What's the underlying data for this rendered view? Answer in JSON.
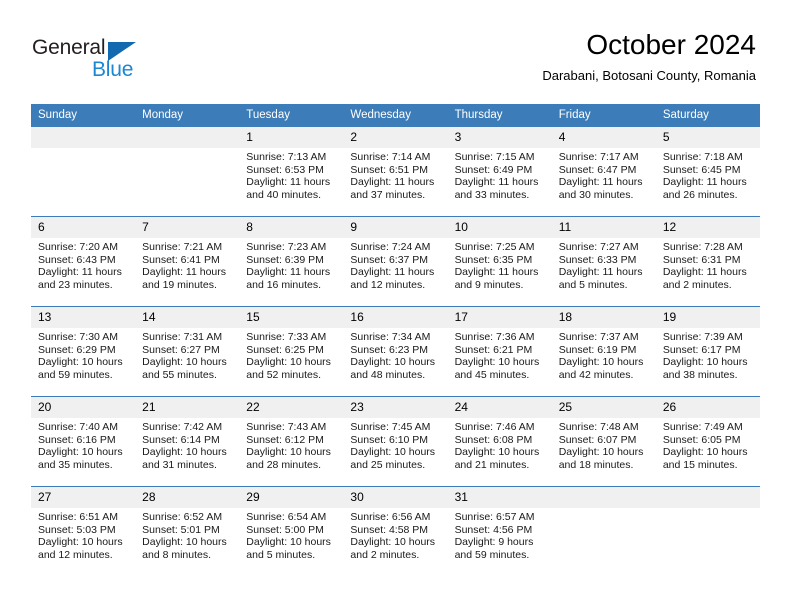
{
  "brand": {
    "name_top": "General",
    "name_bottom": "Blue",
    "accent_color": "#1269b0",
    "accent_color_light": "#1b87d4"
  },
  "header": {
    "title": "October 2024",
    "subtitle": "Darabani, Botosani County, Romania"
  },
  "theme": {
    "header_row_bg": "#3c7cb8",
    "daynum_bg": "#f0f0f0",
    "cell_bg": "#ffffff",
    "text_color": "#000000"
  },
  "weekday_headers": [
    "Sunday",
    "Monday",
    "Tuesday",
    "Wednesday",
    "Thursday",
    "Friday",
    "Saturday"
  ],
  "weeks": [
    [
      {
        "day": "",
        "sunrise": "",
        "sunset": "",
        "daylight": "",
        "empty": true
      },
      {
        "day": "",
        "sunrise": "",
        "sunset": "",
        "daylight": "",
        "empty": true
      },
      {
        "day": "1",
        "sunrise": "Sunrise: 7:13 AM",
        "sunset": "Sunset: 6:53 PM",
        "daylight": "Daylight: 11 hours and 40 minutes."
      },
      {
        "day": "2",
        "sunrise": "Sunrise: 7:14 AM",
        "sunset": "Sunset: 6:51 PM",
        "daylight": "Daylight: 11 hours and 37 minutes."
      },
      {
        "day": "3",
        "sunrise": "Sunrise: 7:15 AM",
        "sunset": "Sunset: 6:49 PM",
        "daylight": "Daylight: 11 hours and 33 minutes."
      },
      {
        "day": "4",
        "sunrise": "Sunrise: 7:17 AM",
        "sunset": "Sunset: 6:47 PM",
        "daylight": "Daylight: 11 hours and 30 minutes."
      },
      {
        "day": "5",
        "sunrise": "Sunrise: 7:18 AM",
        "sunset": "Sunset: 6:45 PM",
        "daylight": "Daylight: 11 hours and 26 minutes."
      }
    ],
    [
      {
        "day": "6",
        "sunrise": "Sunrise: 7:20 AM",
        "sunset": "Sunset: 6:43 PM",
        "daylight": "Daylight: 11 hours and 23 minutes."
      },
      {
        "day": "7",
        "sunrise": "Sunrise: 7:21 AM",
        "sunset": "Sunset: 6:41 PM",
        "daylight": "Daylight: 11 hours and 19 minutes."
      },
      {
        "day": "8",
        "sunrise": "Sunrise: 7:23 AM",
        "sunset": "Sunset: 6:39 PM",
        "daylight": "Daylight: 11 hours and 16 minutes."
      },
      {
        "day": "9",
        "sunrise": "Sunrise: 7:24 AM",
        "sunset": "Sunset: 6:37 PM",
        "daylight": "Daylight: 11 hours and 12 minutes."
      },
      {
        "day": "10",
        "sunrise": "Sunrise: 7:25 AM",
        "sunset": "Sunset: 6:35 PM",
        "daylight": "Daylight: 11 hours and 9 minutes."
      },
      {
        "day": "11",
        "sunrise": "Sunrise: 7:27 AM",
        "sunset": "Sunset: 6:33 PM",
        "daylight": "Daylight: 11 hours and 5 minutes."
      },
      {
        "day": "12",
        "sunrise": "Sunrise: 7:28 AM",
        "sunset": "Sunset: 6:31 PM",
        "daylight": "Daylight: 11 hours and 2 minutes."
      }
    ],
    [
      {
        "day": "13",
        "sunrise": "Sunrise: 7:30 AM",
        "sunset": "Sunset: 6:29 PM",
        "daylight": "Daylight: 10 hours and 59 minutes."
      },
      {
        "day": "14",
        "sunrise": "Sunrise: 7:31 AM",
        "sunset": "Sunset: 6:27 PM",
        "daylight": "Daylight: 10 hours and 55 minutes."
      },
      {
        "day": "15",
        "sunrise": "Sunrise: 7:33 AM",
        "sunset": "Sunset: 6:25 PM",
        "daylight": "Daylight: 10 hours and 52 minutes."
      },
      {
        "day": "16",
        "sunrise": "Sunrise: 7:34 AM",
        "sunset": "Sunset: 6:23 PM",
        "daylight": "Daylight: 10 hours and 48 minutes."
      },
      {
        "day": "17",
        "sunrise": "Sunrise: 7:36 AM",
        "sunset": "Sunset: 6:21 PM",
        "daylight": "Daylight: 10 hours and 45 minutes."
      },
      {
        "day": "18",
        "sunrise": "Sunrise: 7:37 AM",
        "sunset": "Sunset: 6:19 PM",
        "daylight": "Daylight: 10 hours and 42 minutes."
      },
      {
        "day": "19",
        "sunrise": "Sunrise: 7:39 AM",
        "sunset": "Sunset: 6:17 PM",
        "daylight": "Daylight: 10 hours and 38 minutes."
      }
    ],
    [
      {
        "day": "20",
        "sunrise": "Sunrise: 7:40 AM",
        "sunset": "Sunset: 6:16 PM",
        "daylight": "Daylight: 10 hours and 35 minutes."
      },
      {
        "day": "21",
        "sunrise": "Sunrise: 7:42 AM",
        "sunset": "Sunset: 6:14 PM",
        "daylight": "Daylight: 10 hours and 31 minutes."
      },
      {
        "day": "22",
        "sunrise": "Sunrise: 7:43 AM",
        "sunset": "Sunset: 6:12 PM",
        "daylight": "Daylight: 10 hours and 28 minutes."
      },
      {
        "day": "23",
        "sunrise": "Sunrise: 7:45 AM",
        "sunset": "Sunset: 6:10 PM",
        "daylight": "Daylight: 10 hours and 25 minutes."
      },
      {
        "day": "24",
        "sunrise": "Sunrise: 7:46 AM",
        "sunset": "Sunset: 6:08 PM",
        "daylight": "Daylight: 10 hours and 21 minutes."
      },
      {
        "day": "25",
        "sunrise": "Sunrise: 7:48 AM",
        "sunset": "Sunset: 6:07 PM",
        "daylight": "Daylight: 10 hours and 18 minutes."
      },
      {
        "day": "26",
        "sunrise": "Sunrise: 7:49 AM",
        "sunset": "Sunset: 6:05 PM",
        "daylight": "Daylight: 10 hours and 15 minutes."
      }
    ],
    [
      {
        "day": "27",
        "sunrise": "Sunrise: 6:51 AM",
        "sunset": "Sunset: 5:03 PM",
        "daylight": "Daylight: 10 hours and 12 minutes."
      },
      {
        "day": "28",
        "sunrise": "Sunrise: 6:52 AM",
        "sunset": "Sunset: 5:01 PM",
        "daylight": "Daylight: 10 hours and 8 minutes."
      },
      {
        "day": "29",
        "sunrise": "Sunrise: 6:54 AM",
        "sunset": "Sunset: 5:00 PM",
        "daylight": "Daylight: 10 hours and 5 minutes."
      },
      {
        "day": "30",
        "sunrise": "Sunrise: 6:56 AM",
        "sunset": "Sunset: 4:58 PM",
        "daylight": "Daylight: 10 hours and 2 minutes."
      },
      {
        "day": "31",
        "sunrise": "Sunrise: 6:57 AM",
        "sunset": "Sunset: 4:56 PM",
        "daylight": "Daylight: 9 hours and 59 minutes."
      },
      {
        "day": "",
        "sunrise": "",
        "sunset": "",
        "daylight": "",
        "empty": true
      },
      {
        "day": "",
        "sunrise": "",
        "sunset": "",
        "daylight": "",
        "empty": true
      }
    ]
  ]
}
